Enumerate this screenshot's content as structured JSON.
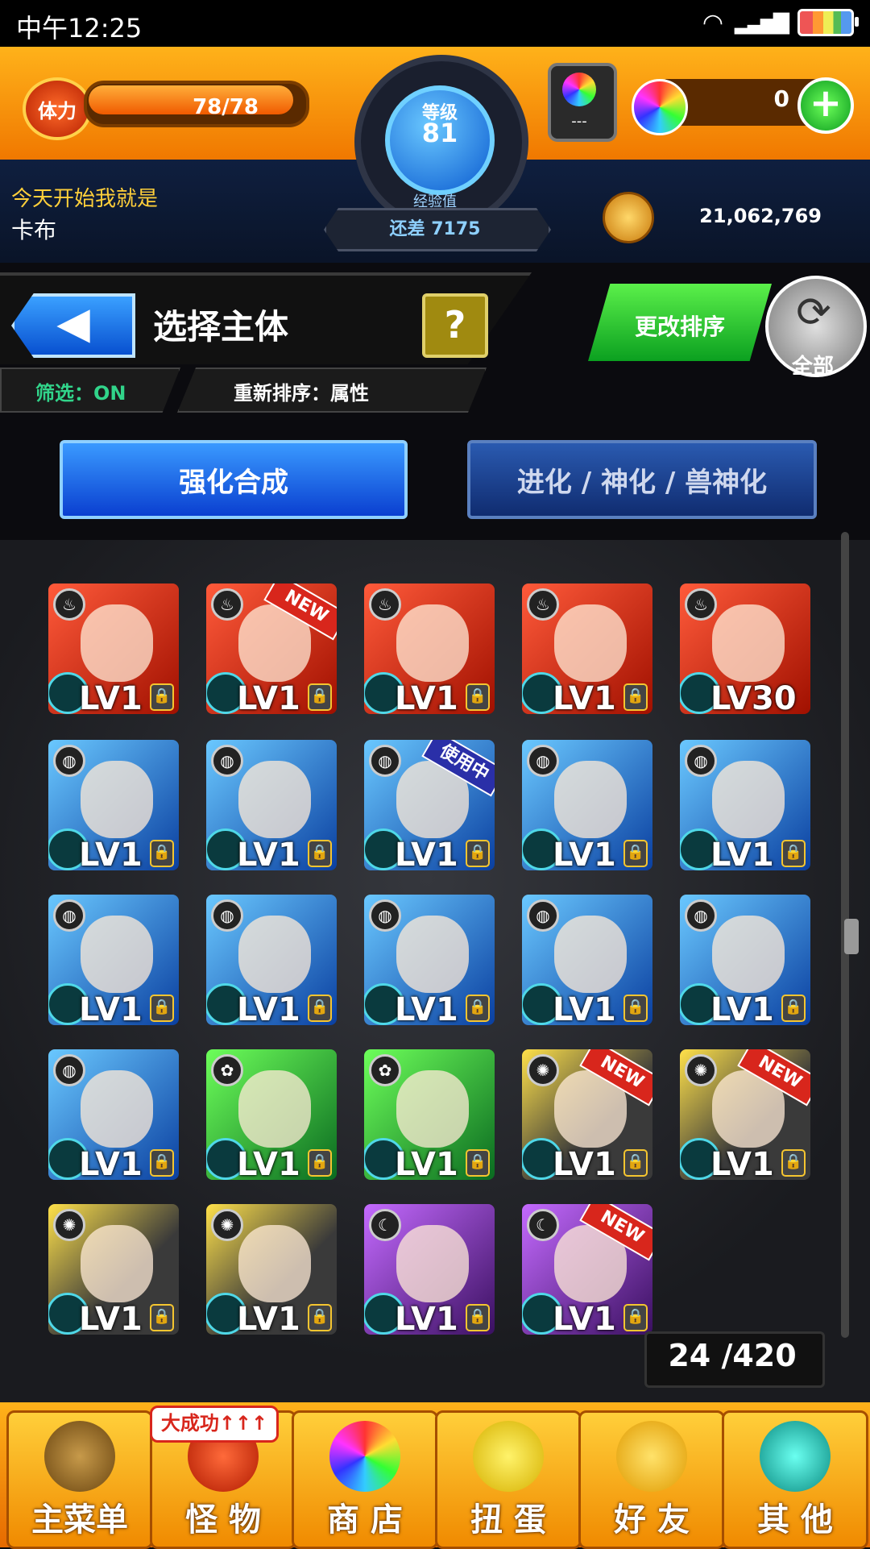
{
  "status_bar": {
    "time": "中午12:25"
  },
  "header": {
    "stamina_label": "体力",
    "stamina_value": "78/78",
    "stamina_fill": 1.0,
    "level_label": "等级",
    "level_value": "81",
    "exp_label": "经验值",
    "exp_remaining": "还差 7175",
    "gacha_ticket": "---",
    "gem_count": "0",
    "gem_plus": "+",
    "player_title": "今天开始我就是",
    "player_name": "卡布",
    "gold": "21,062,769"
  },
  "toolbar": {
    "back": "◀",
    "title": "选择主体",
    "help": "?",
    "filter": "筛选：ON",
    "sort": "重新排序：属性",
    "change_sort": "更改排序",
    "all": "全部"
  },
  "modes": {
    "enhance": "强化合成",
    "evolve": "进化 / 神化 / 兽神化"
  },
  "monsters": [
    {
      "element": "fire",
      "lv": "LV1",
      "badge": ""
    },
    {
      "element": "fire",
      "lv": "LV1",
      "badge": "NEW"
    },
    {
      "element": "fire",
      "lv": "LV1",
      "badge": ""
    },
    {
      "element": "fire",
      "lv": "LV1",
      "badge": ""
    },
    {
      "element": "fire",
      "lv": "LV30",
      "badge": ""
    },
    {
      "element": "water",
      "lv": "LV1",
      "badge": ""
    },
    {
      "element": "water",
      "lv": "LV1",
      "badge": ""
    },
    {
      "element": "water",
      "lv": "LV1",
      "badge": "使用中"
    },
    {
      "element": "water",
      "lv": "LV1",
      "badge": ""
    },
    {
      "element": "water",
      "lv": "LV1",
      "badge": ""
    },
    {
      "element": "water",
      "lv": "LV1",
      "badge": ""
    },
    {
      "element": "water",
      "lv": "LV1",
      "badge": ""
    },
    {
      "element": "water",
      "lv": "LV1",
      "badge": ""
    },
    {
      "element": "water",
      "lv": "LV1",
      "badge": ""
    },
    {
      "element": "water",
      "lv": "LV1",
      "badge": ""
    },
    {
      "element": "water",
      "lv": "LV1",
      "badge": ""
    },
    {
      "element": "wood",
      "lv": "LV1",
      "badge": ""
    },
    {
      "element": "wood",
      "lv": "LV1",
      "badge": ""
    },
    {
      "element": "light",
      "lv": "LV1",
      "badge": "NEW"
    },
    {
      "element": "light",
      "lv": "LV1",
      "badge": "NEW"
    },
    {
      "element": "light",
      "lv": "LV1",
      "badge": ""
    },
    {
      "element": "light",
      "lv": "LV1",
      "badge": ""
    },
    {
      "element": "dark",
      "lv": "LV1",
      "badge": ""
    },
    {
      "element": "dark",
      "lv": "LV1",
      "badge": "NEW"
    }
  ],
  "count": "24 /420",
  "nav": {
    "items": [
      {
        "label": "主菜单",
        "icon": "castle-gate-icon"
      },
      {
        "label": "怪 物",
        "icon": "monster-icon"
      },
      {
        "label": "商 店",
        "icon": "rainbow-orb-icon"
      },
      {
        "label": "扭 蛋",
        "icon": "egg-icon"
      },
      {
        "label": "好 友",
        "icon": "friends-icon"
      },
      {
        "label": "其 他",
        "icon": "other-icon"
      }
    ],
    "bubble": "大成功↑↑↑"
  },
  "colors": {
    "accent": "#f08a00",
    "blue": "#0a3fd0",
    "green": "#0ba020",
    "new_badge": "#d8261c"
  }
}
